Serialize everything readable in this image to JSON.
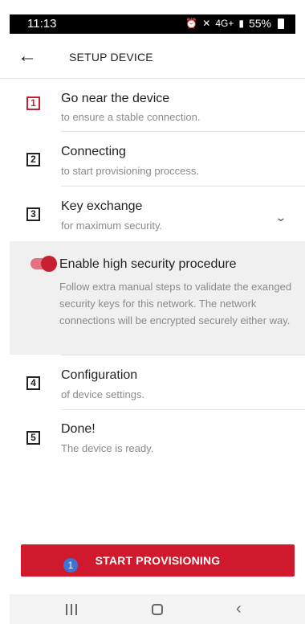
{
  "status_bar": {
    "time": "11:13",
    "network": "4G+",
    "battery": "55%"
  },
  "app_bar": {
    "title": "SETUP DEVICE"
  },
  "steps": [
    {
      "number": "1",
      "title": "Go near the device",
      "subtitle": "to ensure a stable connection.",
      "active": true
    },
    {
      "number": "2",
      "title": "Connecting",
      "subtitle": "to start provisioning proccess."
    },
    {
      "number": "3",
      "title": "Key exchange",
      "subtitle": "for maximum security."
    },
    {
      "number": "4",
      "title": "Configuration",
      "subtitle": "of device settings."
    },
    {
      "number": "5",
      "title": "Done!",
      "subtitle": "The device is ready."
    }
  ],
  "security": {
    "enabled": true,
    "title": "Enable high security procedure",
    "description": "Follow extra manual steps to validate the exanged security keys for this network. The network connections will be encrypted securely either way."
  },
  "start_button": {
    "label": "START PROVISIONING",
    "badge": "1"
  },
  "colors": {
    "accent": "#d0192c",
    "badge": "#3b73d8",
    "panel": "#f0f0f0"
  },
  "icons": {
    "back": "arrow-left-icon",
    "expand": "chevron-down-icon",
    "nav_recents": "recent-apps-icon",
    "nav_home": "home-icon",
    "nav_back": "chevron-left-icon"
  }
}
